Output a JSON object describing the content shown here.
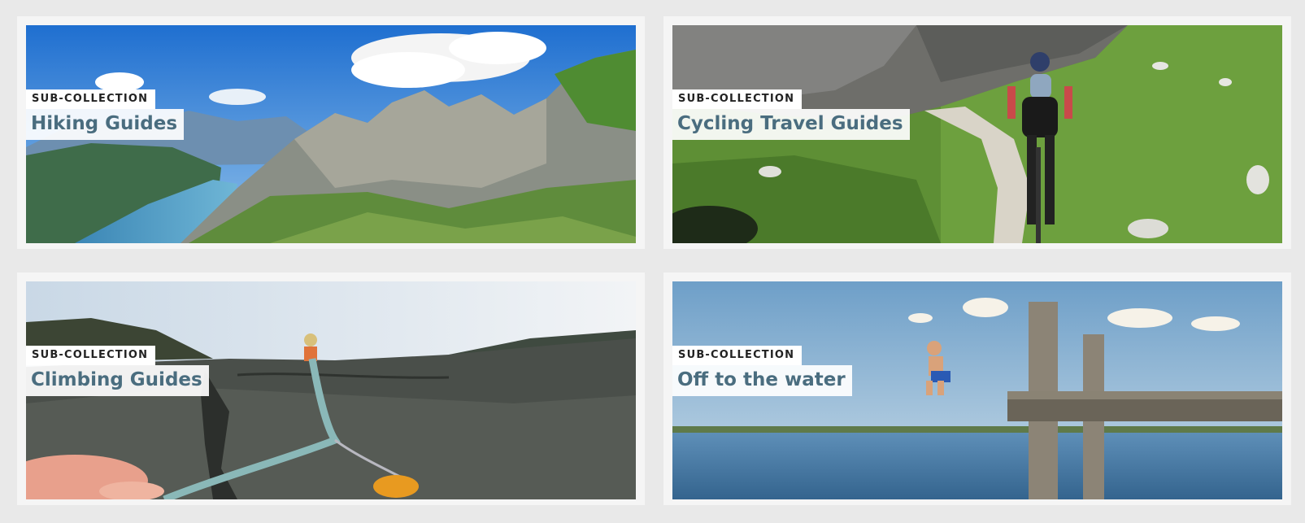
{
  "cards": [
    {
      "kicker": "SUB-COLLECTION",
      "title": "Hiking Guides",
      "scene": "mountain-lake-photo"
    },
    {
      "kicker": "SUB-COLLECTION",
      "title": "Cycling Travel Guides",
      "scene": "mountain-biker-photo"
    },
    {
      "kicker": "SUB-COLLECTION",
      "title": "Climbing Guides",
      "scene": "rock-climbing-rope-photo"
    },
    {
      "kicker": "SUB-COLLECTION",
      "title": "Off to the water",
      "scene": "lake-jetty-jump-photo"
    }
  ],
  "colors": {
    "page_bg": "#e9e9e9",
    "card_bg": "#f5f5f5",
    "title_color": "#4a6d7f",
    "kicker_color": "#222222"
  }
}
